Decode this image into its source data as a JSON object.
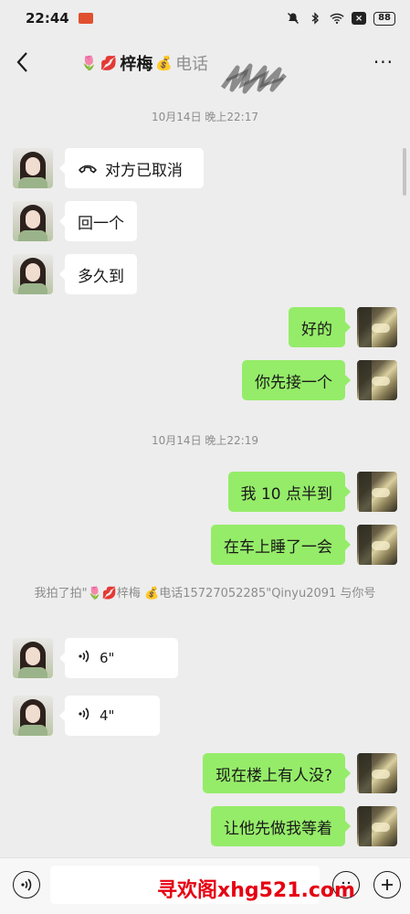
{
  "status_bar": {
    "time": "22:44",
    "battery": "88"
  },
  "header": {
    "emoji_1": "🌷",
    "emoji_2": "💋",
    "name": "梓梅",
    "emoji_3": "💰",
    "suffix": "电话",
    "more_label": "···"
  },
  "timestamps": [
    "10月14日 晚上22:17",
    "10月14日 晚上22:19"
  ],
  "messages": [
    {
      "side": "in",
      "kind": "call",
      "text": "对方已取消"
    },
    {
      "side": "in",
      "kind": "text",
      "text": "回一个"
    },
    {
      "side": "in",
      "kind": "text",
      "text": "多久到"
    },
    {
      "side": "out",
      "kind": "text",
      "text": "好的"
    },
    {
      "side": "out",
      "kind": "text",
      "text": "你先接一个"
    },
    {
      "side": "out",
      "kind": "text",
      "text": "我 10 点半到"
    },
    {
      "side": "out",
      "kind": "text",
      "text": "在车上睡了一会"
    },
    {
      "side": "in",
      "kind": "voice",
      "text": "6\""
    },
    {
      "side": "in",
      "kind": "voice",
      "text": "4\""
    },
    {
      "side": "out",
      "kind": "text",
      "text": "现在楼上有人没?"
    },
    {
      "side": "out",
      "kind": "text",
      "text": "让他先做我等着"
    }
  ],
  "system_message": "我拍了拍\"🌷💋梓梅 💰电话15727052285\"Qinyu2091 与你号",
  "watermark": "寻欢阁xhg521.com",
  "colors": {
    "outgoing_bubble": "#95ec69",
    "incoming_bubble": "#ffffff",
    "background": "#ededed"
  }
}
